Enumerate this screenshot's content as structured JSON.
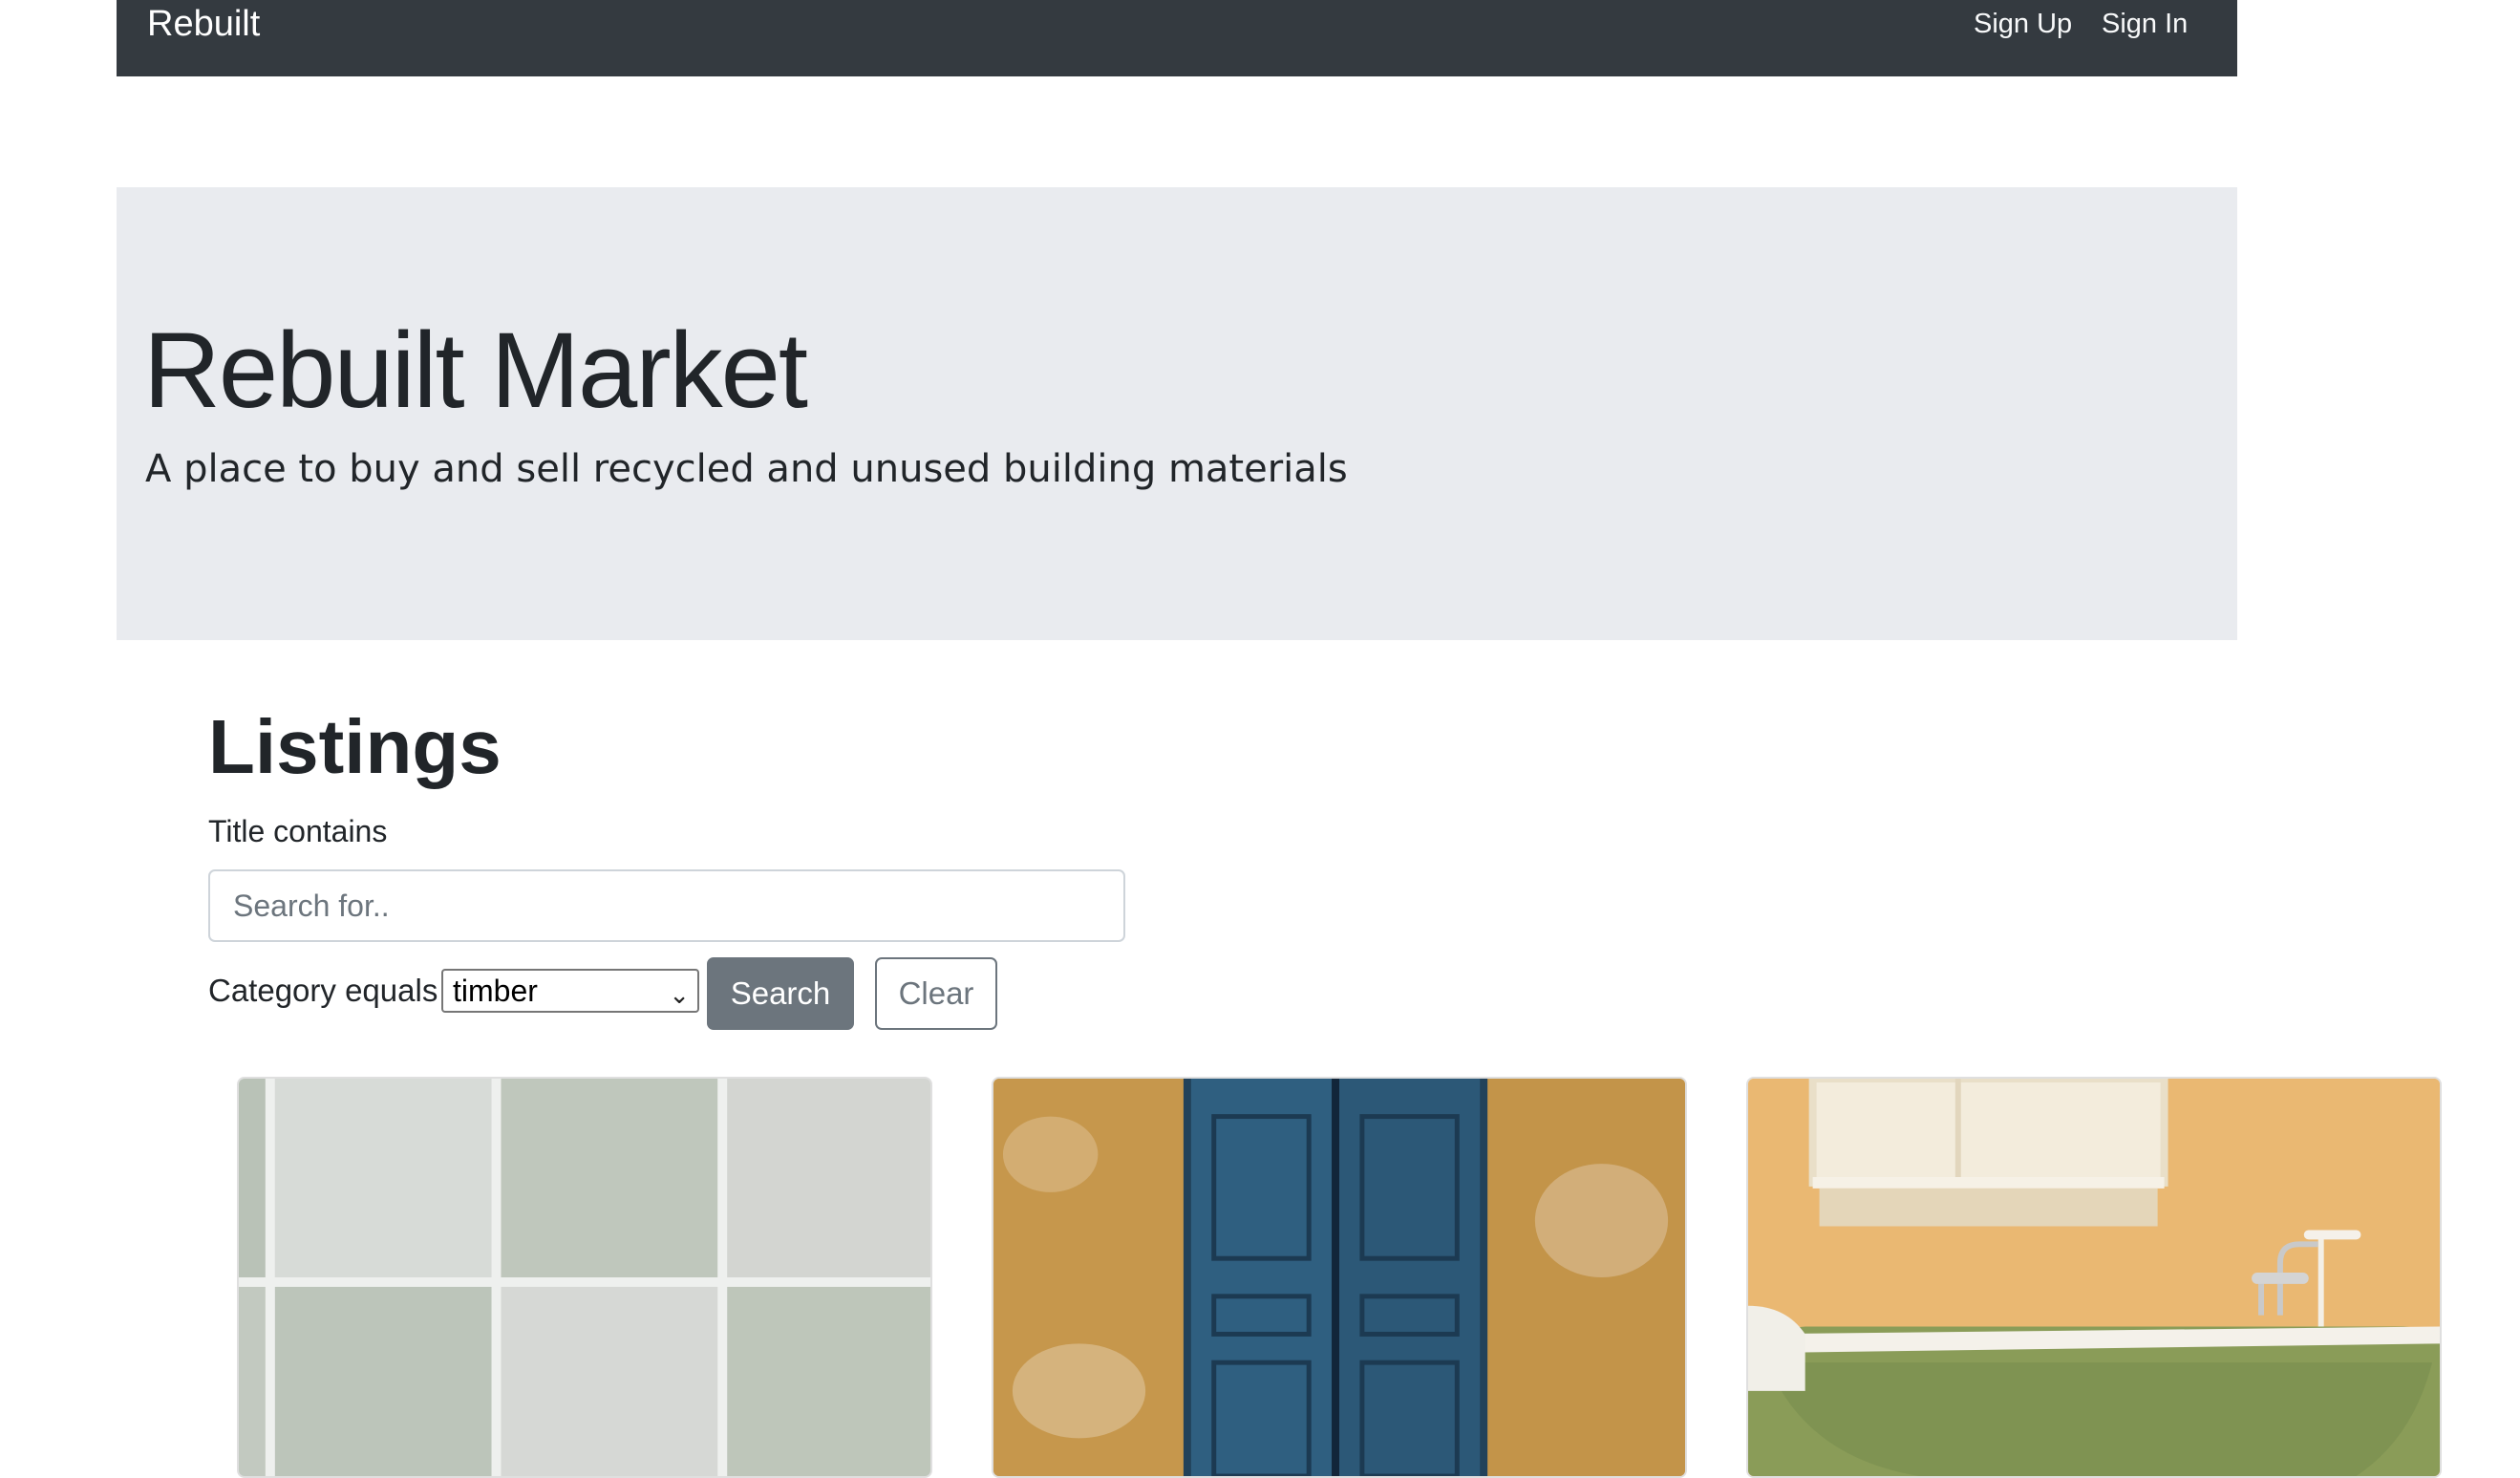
{
  "navbar": {
    "brand": "Rebuilt",
    "links": [
      "Sign Up",
      "Sign In"
    ]
  },
  "hero": {
    "title": "Rebuilt Market",
    "lead": "A place to buy and sell recycled and unused building materials"
  },
  "listings": {
    "heading": "Listings",
    "title_filter_label": "Title contains",
    "search_placeholder": "Search for..",
    "search_value": "",
    "category_label": "Category equals",
    "category_selected": "timber",
    "search_button": "Search",
    "clear_button": "Clear",
    "cards": [
      {
        "image": "tiles-photo"
      },
      {
        "image": "blue-door-photo"
      },
      {
        "image": "bathtub-photo"
      }
    ]
  },
  "colors": {
    "navbar_bg": "#343a40",
    "hero_bg": "#e9ebef",
    "secondary": "#6c757d"
  }
}
